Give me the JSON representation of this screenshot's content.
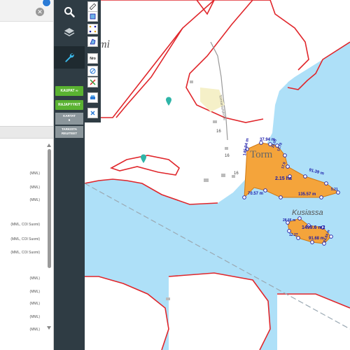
{
  "left_panel": {
    "close_icon": "close-icon",
    "status_dot": "blue-dot",
    "sources": [
      "(MML)",
      "(MML)",
      "(MML)",
      "(MML, COI Suomi)",
      "(MML, COI Suomi)",
      "(MML, COI Suomi)",
      "(MML)",
      "(MML)",
      "(MML)",
      "(MML)",
      "(MML)"
    ]
  },
  "toolbar": {
    "search_icon": "search-icon",
    "layers_icon": "layers-icon",
    "tools_icon": "wrench-icon",
    "kaupat_label": "KAUPAT ∞",
    "rajapyykit_label": "RAJAPYYKIT",
    "kartat_line1": "KARTAT",
    "kartat_line2": "6",
    "tarkista_line1": "TARKISTA",
    "tarkista_line2": "REUITEET"
  },
  "tool_strip": {
    "nro_label": "Nro",
    "tools": [
      "ruler-icon",
      "square-icon",
      "move-icon",
      "polygon-icon",
      "nro-icon",
      "disable-icon",
      "color-icon",
      "print-icon",
      "close-icon"
    ]
  },
  "map": {
    "place_labels": {
      "mi_fragment": "mi",
      "tormo": "Torm",
      "kusiassa": "Kusiassa",
      "road_name": "Tormanlahdentie",
      "house_16a": "16",
      "house_16b": "16",
      "house_16c": "16"
    },
    "parcel_area_main": "2.15 ha",
    "parcel_area_small": "1499.6 m2",
    "measurements": {
      "m_37_94": "37.94 m",
      "m_145_94": "145.94 m",
      "m_91_39": "91.39 m",
      "m_135_57": "135.57 m",
      "m_70_57": "70.57 m",
      "m_91_68": "91.68 m",
      "m_28_66": "28.66 m",
      "m_small_a": "24.05",
      "m_small_b": "12.78",
      "m_small_c": "17.9",
      "m_small_d": "5.21",
      "m_small_e": "24.84 m",
      "m_small_f": "12.27"
    },
    "colors": {
      "water": "#aee0f8",
      "land": "#ffffff",
      "parcel_border": "#e0262b",
      "selected_parcel": "#f4a43b",
      "measurement_text": "#1a1aa8"
    }
  }
}
